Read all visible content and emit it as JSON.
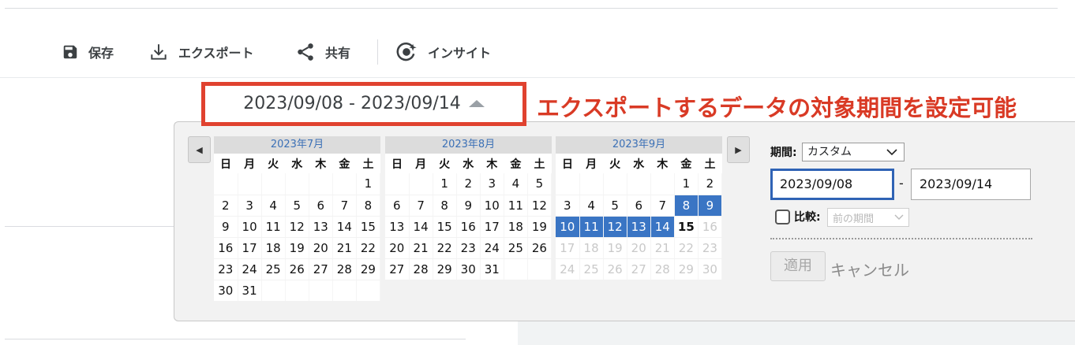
{
  "toolbar": {
    "save": "保存",
    "export": "エクスポート",
    "share": "共有",
    "insights": "インサイト"
  },
  "date_range": {
    "display": "2023/09/08 - 2023/09/14"
  },
  "annotation": {
    "text": "エクスポートするデータの対象期間を設定可能",
    "color": "#d93a25"
  },
  "calendar": {
    "weekdays": [
      "日",
      "月",
      "火",
      "水",
      "木",
      "金",
      "土"
    ],
    "months": [
      {
        "title": "2023年7月",
        "rows": [
          [
            "",
            "",
            "",
            "",
            "",
            "",
            "1"
          ],
          [
            "2",
            "3",
            "4",
            "5",
            "6",
            "7",
            "8"
          ],
          [
            "9",
            "10",
            "11",
            "12",
            "13",
            "14",
            "15"
          ],
          [
            "16",
            "17",
            "18",
            "19",
            "20",
            "21",
            "22"
          ],
          [
            "23",
            "24",
            "25",
            "26",
            "27",
            "28",
            "29"
          ],
          [
            "30",
            "31",
            "",
            "",
            "",
            "",
            ""
          ]
        ]
      },
      {
        "title": "2023年8月",
        "rows": [
          [
            "",
            "",
            "1",
            "2",
            "3",
            "4",
            "5"
          ],
          [
            "6",
            "7",
            "8",
            "9",
            "10",
            "11",
            "12"
          ],
          [
            "13",
            "14",
            "15",
            "16",
            "17",
            "18",
            "19"
          ],
          [
            "20",
            "21",
            "22",
            "23",
            "24",
            "25",
            "26"
          ],
          [
            "27",
            "28",
            "29",
            "30",
            "31",
            "",
            ""
          ]
        ]
      },
      {
        "title": "2023年9月",
        "rows": [
          [
            "",
            "",
            "",
            "",
            "",
            "1",
            "2"
          ],
          [
            "3",
            "4",
            "5",
            "6",
            "7",
            "8",
            "9"
          ],
          [
            "10",
            "11",
            "12",
            "13",
            "14",
            "15",
            "16"
          ],
          [
            "17",
            "18",
            "19",
            "20",
            "21",
            "22",
            "23"
          ],
          [
            "24",
            "25",
            "26",
            "27",
            "28",
            "29",
            "30"
          ]
        ],
        "selected": [
          "8",
          "9",
          "10",
          "11",
          "12",
          "13",
          "14"
        ],
        "today": "15",
        "disabled_from": 16
      }
    ],
    "selected_color": "#3a75c4",
    "month_title_color": "#3b70b6"
  },
  "controls": {
    "period_label": "期間:",
    "period_value": "カスタム",
    "start_date": "2023/09/08",
    "end_date": "2023/09/14",
    "separator": "-",
    "compare_label": "比較:",
    "compare_value": "前の期間",
    "compare_checked": false,
    "apply_label": "適用",
    "cancel_label": "キャンセル"
  }
}
